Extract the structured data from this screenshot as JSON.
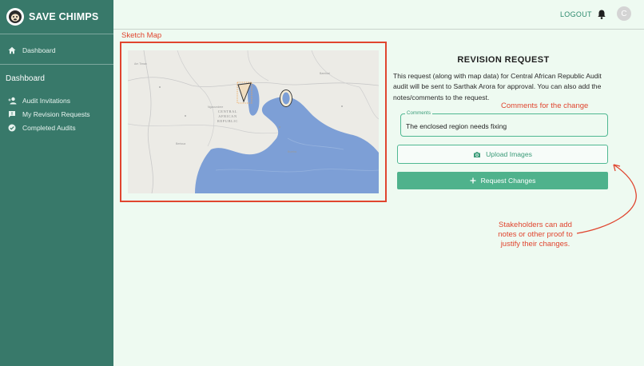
{
  "brand": {
    "name": "SAVE CHIMPS"
  },
  "sidebar": {
    "top_items": [
      {
        "label": "Dashboard",
        "icon": "home-icon"
      }
    ],
    "section_title": "Dashboard",
    "items": [
      {
        "label": "Audit Invitations",
        "icon": "add-user-icon"
      },
      {
        "label": "My Revision Requests",
        "icon": "feedback-icon"
      },
      {
        "label": "Completed Audits",
        "icon": "check-circle-icon"
      }
    ]
  },
  "topbar": {
    "logout_label": "LOGOUT",
    "avatar_initial": "C"
  },
  "annotations": {
    "sketch_map": "Sketch Map",
    "comments_note": "Comments for the change",
    "stakeholders_line1": "Stakeholders can add",
    "stakeholders_line2": "notes or other proof to",
    "stakeholders_line3": "justify their changes.",
    "color": "#e0452f"
  },
  "map": {
    "country_label_line1": "CENTRAL",
    "country_label_line2": "AFRICAN",
    "country_label_line3": "REPUBLIC"
  },
  "revision": {
    "title": "REVISION REQUEST",
    "description": "This request (along with map data) for Central African Republic Audit audit will be sent to Sarthak Arora for approval. You can also add the notes/comments to the request.",
    "comments_label": "Comments",
    "comments_value": "The enclosed region needs fixing",
    "upload_label": "Upload Images",
    "request_label": "Request Changes"
  },
  "colors": {
    "sidebar": "#38796a",
    "accent": "#4fb28c",
    "background": "#eefaf1",
    "water": "#7d9fd6"
  }
}
